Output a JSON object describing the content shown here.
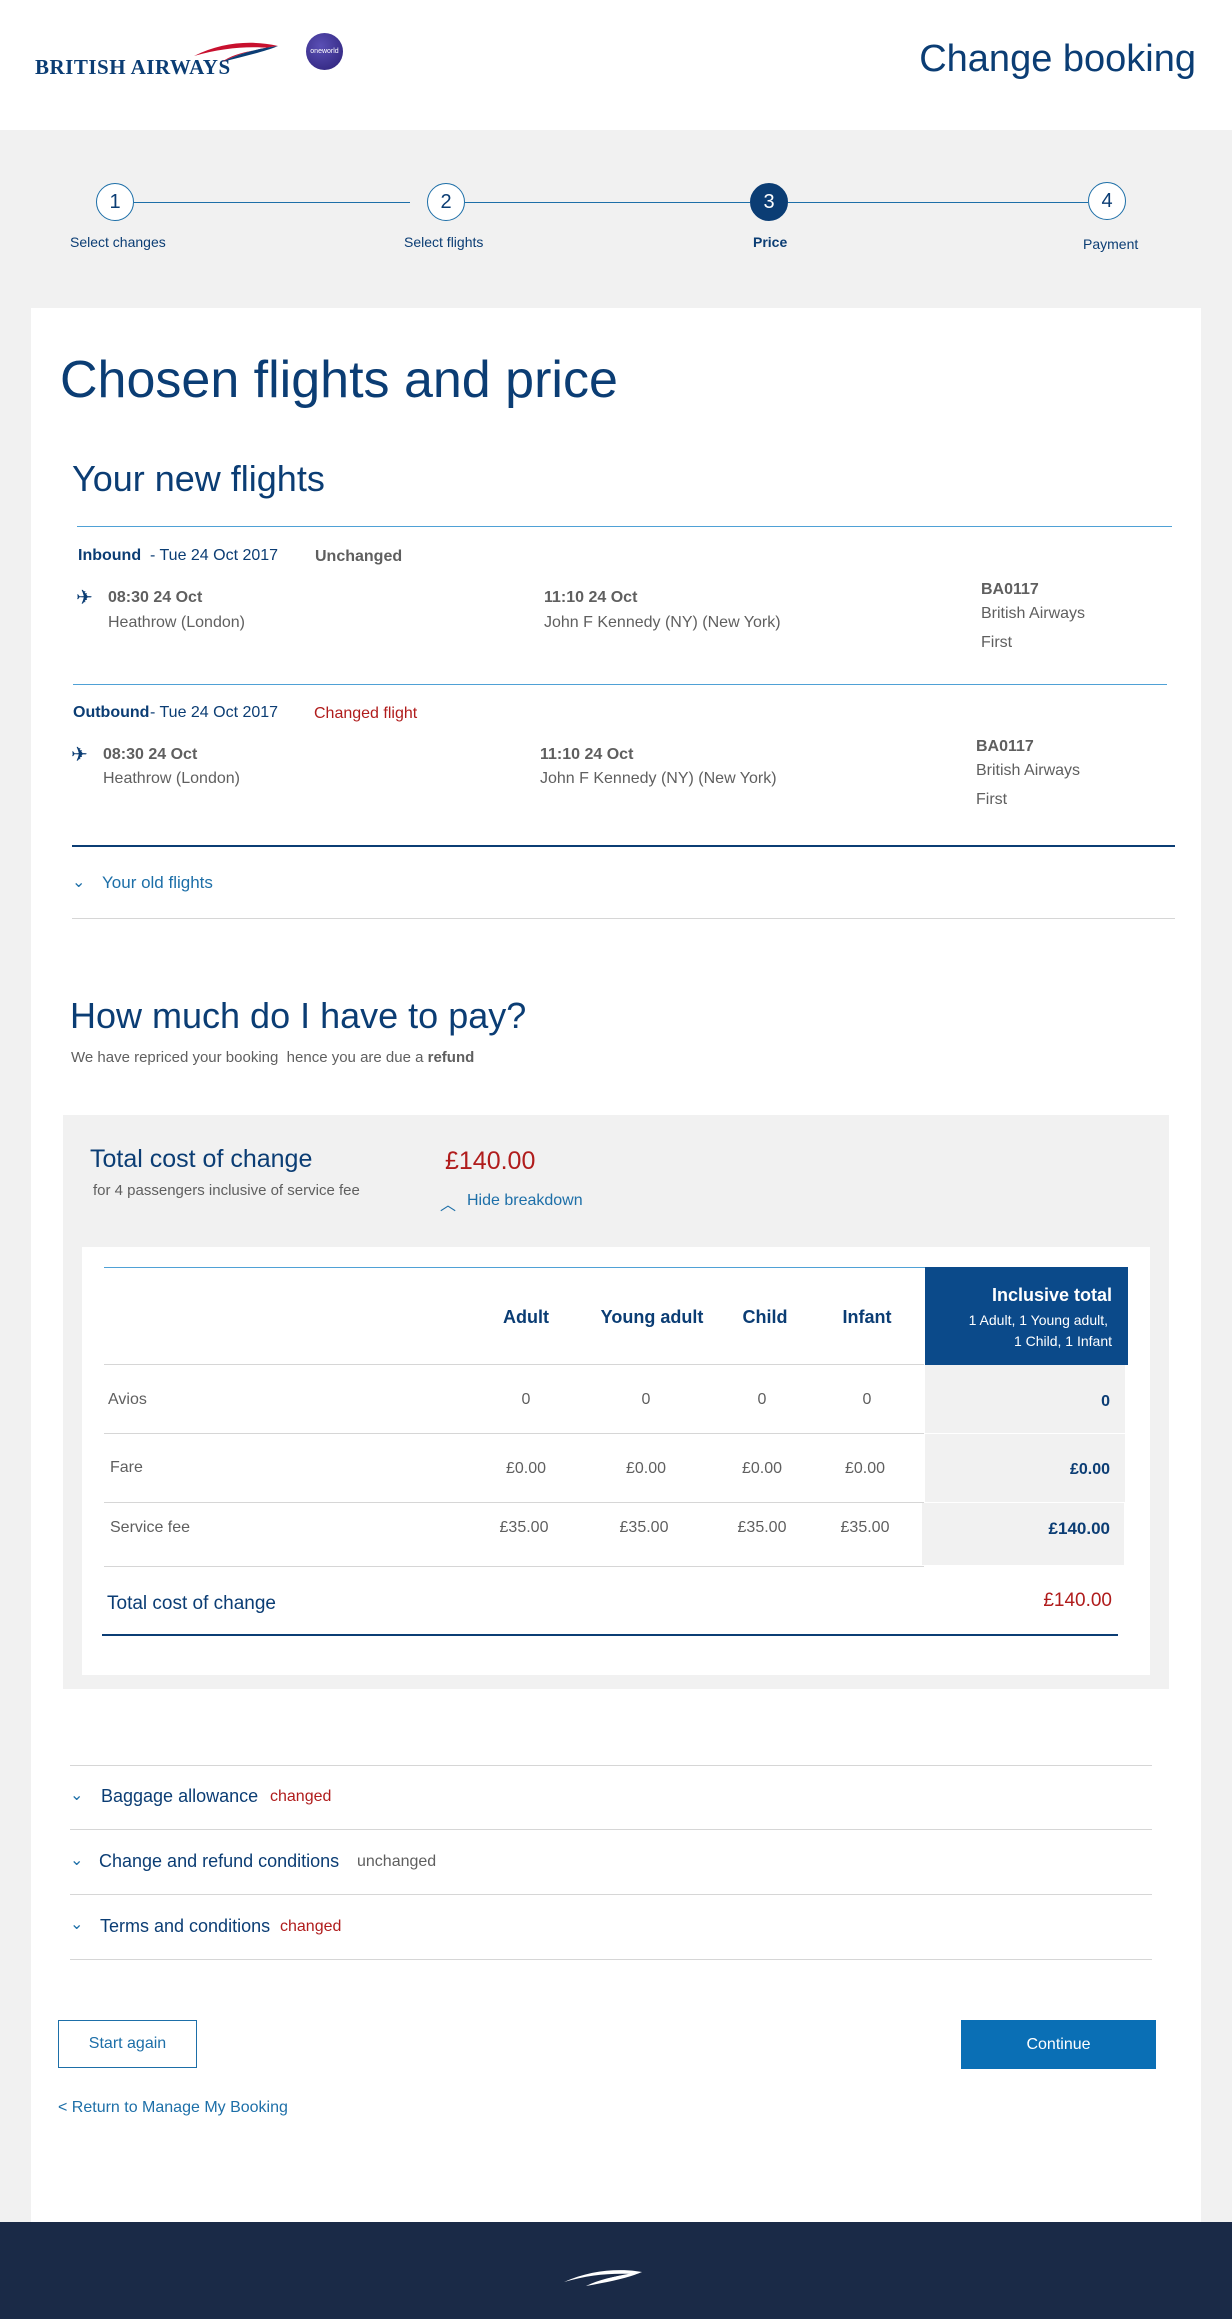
{
  "header": {
    "brand_name": "BRITISH AIRWAYS",
    "alliance_logo_text": "oneworld",
    "page_heading": "Change booking"
  },
  "stepper": {
    "steps": [
      {
        "number": "1",
        "label": "Select changes"
      },
      {
        "number": "2",
        "label": "Select flights"
      },
      {
        "number": "3",
        "label": "Price"
      },
      {
        "number": "4",
        "label": "Payment"
      }
    ],
    "current_step": 3
  },
  "main": {
    "title": "Chosen flights and price",
    "new_flights_title": "Your new flights",
    "inbound": {
      "direction": "Inbound",
      "date": "- Tue 24 Oct 2017",
      "status": "Unchanged",
      "depart_time": "08:30 24 Oct",
      "depart_airport": "Heathrow (London)",
      "arrive_time": "11:10 24 Oct",
      "arrive_airport": "John F Kennedy (NY) (New York)",
      "flight_number": "BA0117",
      "carrier": "British Airways",
      "cabin": "First"
    },
    "outbound": {
      "direction": "Outbound",
      "date": "- Tue 24 Oct 2017",
      "status": "Changed flight",
      "depart_time": "08:30 24 Oct",
      "depart_airport": "Heathrow (London)",
      "arrive_time": "11:10 24 Oct",
      "arrive_airport": "John F Kennedy (NY) (New York)",
      "flight_number": "BA0117",
      "carrier": "British Airways",
      "cabin": "First"
    },
    "old_flights_toggle": "Your old flights"
  },
  "payment": {
    "title": "How much do I have to pay?",
    "subtitle_prefix": "We have repriced your booking  hence you are due a ",
    "subtitle_bold": "refund",
    "total_label": "Total cost of change",
    "total_sub": "for 4 passengers inclusive of service fee",
    "total_amount": "£140.00",
    "breakdown_toggle": "Hide breakdown",
    "table": {
      "columns": [
        "Adult",
        "Young adult",
        "Child",
        "Infant"
      ],
      "inclusive_title": "Inclusive total",
      "inclusive_sub_1": "1 Adult, 1 Young adult,",
      "inclusive_sub_2": "1 Child, 1 Infant",
      "rows": [
        {
          "label": "Avios",
          "values": [
            "0",
            "0",
            "0",
            "0"
          ],
          "total": "0"
        },
        {
          "label": "Fare",
          "values": [
            "£0.00",
            "£0.00",
            "£0.00",
            "£0.00"
          ],
          "total": "£0.00"
        },
        {
          "label": "Service fee",
          "values": [
            "£35.00",
            "£35.00",
            "£35.00",
            "£35.00"
          ],
          "total": "£140.00"
        }
      ],
      "footer_label": "Total cost of change",
      "footer_total": "£140.00"
    }
  },
  "accordions": [
    {
      "label": "Baggage allowance",
      "tag": "changed"
    },
    {
      "label": "Change and refund conditions",
      "tag": "unchanged"
    },
    {
      "label": "Terms and conditions",
      "tag": "changed"
    }
  ],
  "actions": {
    "start_again": "Start again",
    "continue": "Continue",
    "return_link": "< Return to Manage My Booking"
  },
  "colors": {
    "navy": "#0b3d74",
    "link_blue": "#1d6fa8",
    "alert_red": "#b01c1c",
    "continue_blue": "#0a6fb5",
    "footer_navy": "#1a2a47"
  }
}
